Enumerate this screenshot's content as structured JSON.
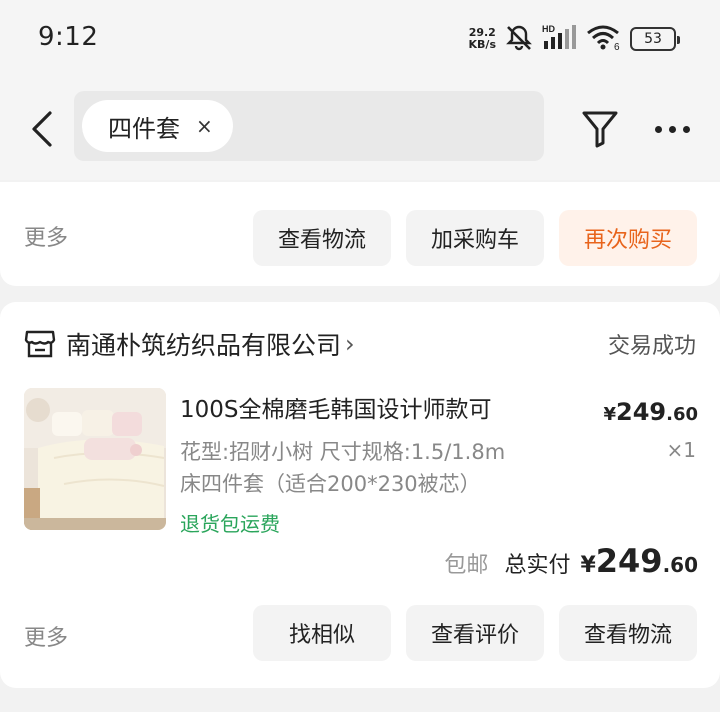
{
  "status_bar": {
    "time": "9:12",
    "net_speed_value": "29.2",
    "net_speed_unit": "KB/s",
    "battery": "53",
    "icons": [
      "net-speed-icon",
      "mute-icon",
      "hd-signal-icon",
      "wifi-icon",
      "battery-icon"
    ]
  },
  "nav": {
    "back_icon": "chevron-left-icon",
    "search_chip": "四件套",
    "search_chip_close": "×",
    "filter_icon": "filter-icon",
    "more_icon": "more-icon"
  },
  "prev_order": {
    "more_label": "更多",
    "buttons": [
      "查看物流",
      "加采购车",
      "再次购买"
    ]
  },
  "order": {
    "shop_name": "南通朴筑纺织品有限公司",
    "shop_chevron": "›",
    "status": "交易成功",
    "product": {
      "title": "100S全棉磨毛韩国设计师款可",
      "spec_line1": "花型:招财小树 尺寸规格:1.5/1.8m",
      "spec_line2": "床四件套（适合200*230被芯）",
      "return_tag": "退货包运费",
      "price_currency": "¥",
      "price_int": "249",
      "price_dec": ".60",
      "quantity": "×1"
    },
    "shipping": "包邮",
    "total_label": "总实付",
    "total_currency": "¥",
    "total_int": "249",
    "total_dec": ".60",
    "more_label": "更多",
    "buttons": [
      "找相似",
      "查看评价",
      "查看物流"
    ]
  },
  "colors": {
    "accent_orange": "#e8641c",
    "accent_orange_bg": "#fff2ea",
    "green_tag": "#2aa55b"
  }
}
